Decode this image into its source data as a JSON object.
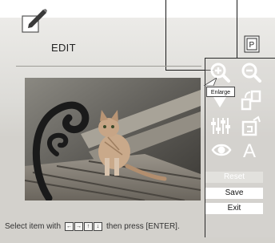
{
  "header": {
    "title": "EDIT"
  },
  "tooltip": {
    "label": "Enlarge"
  },
  "buttons": {
    "reset": "Reset",
    "save": "Save",
    "exit": "Exit"
  },
  "status": {
    "before": "Select item with",
    "after": "then press [ENTER]."
  },
  "colors": {
    "frame": "#d3d1cc",
    "panel_border": "#2a2a2a",
    "button_bg": "#ffffff",
    "disabled_bg": "#e2e1dd"
  },
  "icons": [
    "edit-icon",
    "print-mode-icon",
    "zoom-in-icon",
    "zoom-out-icon",
    "move-icon",
    "rotate-icon",
    "adjust-icon",
    "filter-icon",
    "red-eye-icon",
    "text-icon",
    "arrow-keys-icon"
  ]
}
